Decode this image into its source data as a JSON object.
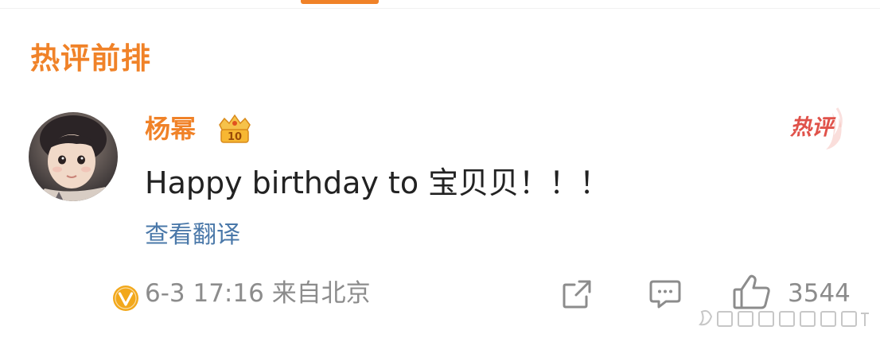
{
  "colors": {
    "accent_orange": "#f08228",
    "link_blue": "#4a78a9",
    "hot_red": "#e0524a",
    "text_primary": "#222222",
    "text_secondary": "#8c8c8c",
    "verified_gold": "#f2a81b"
  },
  "section": {
    "title": "热评前排"
  },
  "comment": {
    "username": "杨幂",
    "member_badge_icon": "vip-crown-icon",
    "hot_badge": "热评",
    "text": "Happy birthday to 宝贝贝！！！",
    "translate_label": "查看翻译",
    "timestamp": "6-3 17:16",
    "location": "来自北京",
    "like_count": "3544"
  },
  "icons": {
    "share": "share-icon",
    "comment": "comment-icon",
    "like": "thumbs-up-icon",
    "verified": "verified-badge-icon"
  }
}
